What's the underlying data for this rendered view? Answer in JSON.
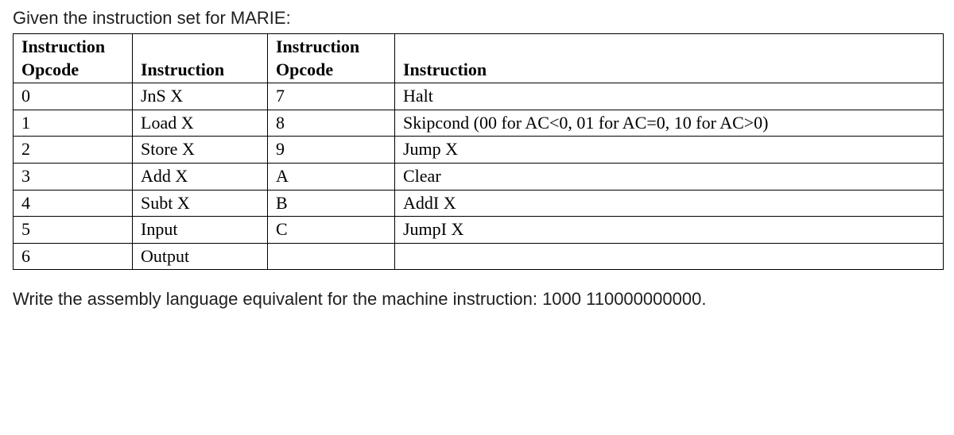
{
  "intro": "Given the instruction set for MARIE:",
  "headers": {
    "opcode_line1": "Instruction",
    "opcode_line2": "Opcode",
    "instruction": "Instruction"
  },
  "rows": [
    {
      "op1": "0",
      "ins1": "JnS X",
      "op2": "7",
      "ins2": "Halt"
    },
    {
      "op1": "1",
      "ins1": "Load X",
      "op2": "8",
      "ins2": "Skipcond (00 for AC<0, 01 for AC=0, 10 for AC>0)"
    },
    {
      "op1": "2",
      "ins1": "Store X",
      "op2": "9",
      "ins2": "Jump X"
    },
    {
      "op1": "3",
      "ins1": "Add X",
      "op2": "A",
      "ins2": "Clear"
    },
    {
      "op1": "4",
      "ins1": "Subt X",
      "op2": "B",
      "ins2": "AddI X"
    },
    {
      "op1": "5",
      "ins1": "Input",
      "op2": "C",
      "ins2": "JumpI X"
    },
    {
      "op1": "6",
      "ins1": "Output",
      "op2": "",
      "ins2": ""
    }
  ],
  "question": "Write the assembly language equivalent for the machine instruction: 1000 110000000000."
}
